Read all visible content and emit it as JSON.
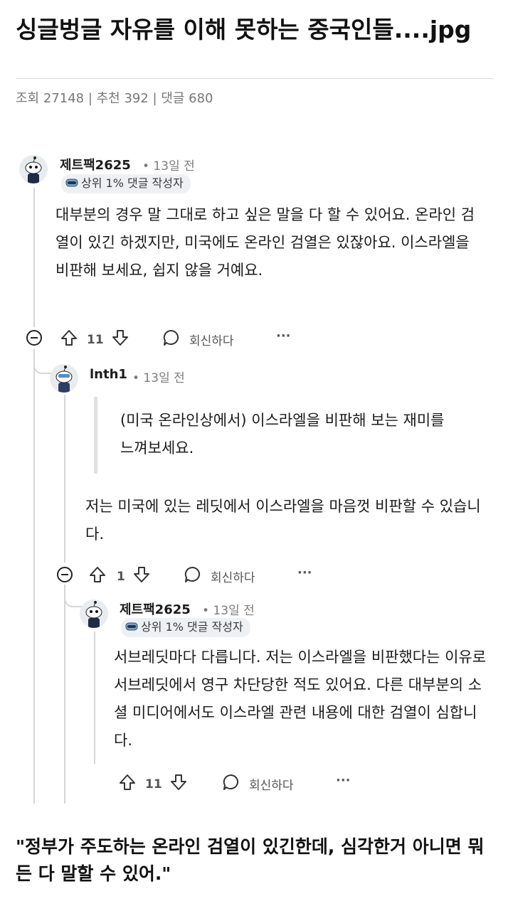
{
  "post": {
    "title": "싱글벙글 자유를 이해 못하는 중국인들....jpg",
    "meta": "조회 27148 | 추천 392 | 댓글 680"
  },
  "comments": [
    {
      "username": "제트팩2625",
      "time": "• 13일 전",
      "flair": "상위 1% 댓글 작성자",
      "body": "대부분의 경우 말 그대로 하고 싶은 말을 다 할 수 있어요. 온라인 검열이 있긴 하겠지만, 미국에도 온라인 검열은 있잖아요. 이스라엘을 비판해 보세요, 쉽지 않을 거예요.",
      "votes": "11",
      "reply": "회신하다",
      "more": "···"
    },
    {
      "username": "lnth1",
      "time": "• 13일 전",
      "quote": "(미국 온라인상에서) 이스라엘을 비판해 보는 재미를 느껴보세요.",
      "body": "저는 미국에 있는 레딧에서 이스라엘을 마음껏 비판할 수 있습니다.",
      "votes": "1",
      "reply": "회신하다",
      "more": "···"
    },
    {
      "username": "제트팩2625",
      "time": "• 13일 전",
      "flair": "상위 1% 댓글 작성자",
      "body": "서브레딧마다 다릅니다. 저는 이스라엘을 비판했다는 이유로 서브레딧에서 영구 차단당한 적도 있어요. 다른 대부분의 소셜 미디어에서도 이스라엘 관련 내용에 대한 검열이 심합니다.",
      "votes": "11",
      "reply": "회신하다",
      "more": "···"
    }
  ],
  "footer": {
    "caption": "\"정부가 주도하는 온라인 검열이 있긴한데, 심각한거 아니면 뭐든 다 말할 수 있어.\""
  }
}
